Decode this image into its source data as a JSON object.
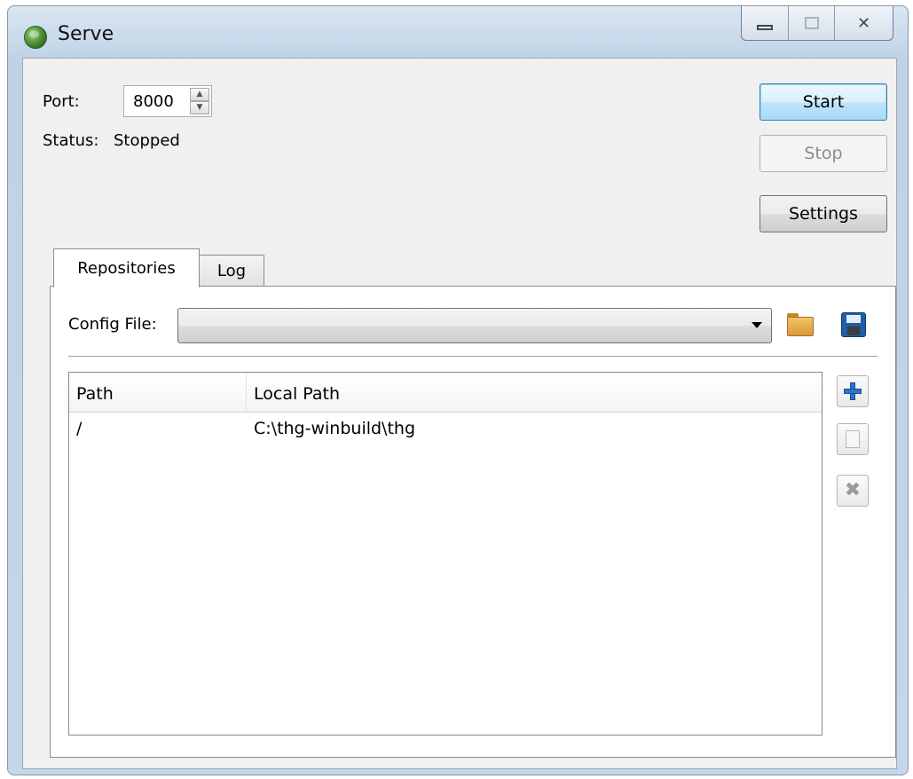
{
  "window": {
    "title": "Serve",
    "icon": "globe-icon",
    "controls": {
      "minimize": "minimize-icon",
      "maximize": "maximize-icon",
      "close": "✕"
    }
  },
  "server": {
    "port_label": "Port:",
    "port_value": "8000",
    "status_label": "Status:",
    "status_value": "Stopped"
  },
  "buttons": {
    "start": "Start",
    "stop": "Stop",
    "settings": "Settings"
  },
  "tabs": [
    {
      "label": "Repositories",
      "active": true
    },
    {
      "label": "Log",
      "active": false
    }
  ],
  "repositories": {
    "config_file_label": "Config File:",
    "config_file_value": "",
    "open_icon": "folder-open-icon",
    "save_icon": "save-icon",
    "columns": [
      "Path",
      "Local Path"
    ],
    "rows": [
      {
        "path": "/",
        "local_path": "C:\\thg-winbuild\\thg"
      }
    ],
    "side_buttons": [
      "add-icon",
      "edit-icon",
      "remove-icon"
    ]
  },
  "colors": {
    "default_button": "#a7d9f5",
    "window_frame": "#c4d6e9"
  }
}
